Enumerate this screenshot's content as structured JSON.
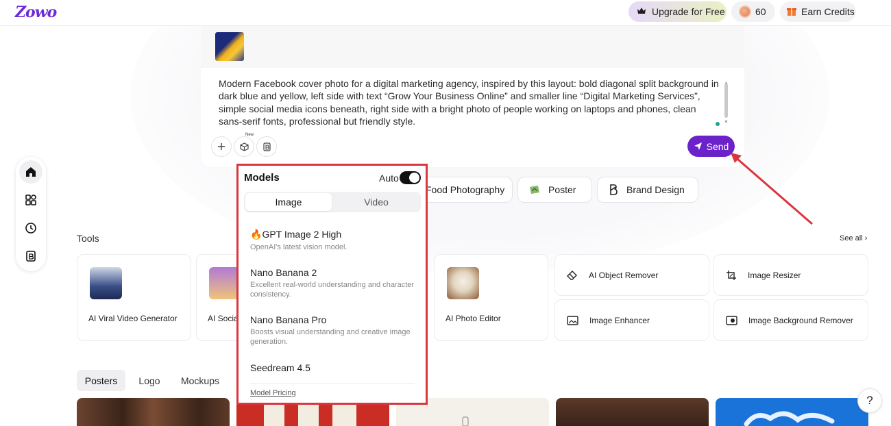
{
  "header": {
    "logo": "Zowo",
    "upgrade_label": "Upgrade for Free",
    "credits_count": "60",
    "earn_label": "Earn Credits"
  },
  "sidebar": {
    "items": [
      {
        "icon": "home-icon"
      },
      {
        "icon": "apps-icon"
      },
      {
        "icon": "history-icon"
      },
      {
        "icon": "brand-icon"
      }
    ]
  },
  "prompt": {
    "text": "Modern Facebook cover photo for a digital marketing agency, inspired by this layout: bold diagonal split background in dark blue and yellow, left side with text “Grow Your Business Online” and smaller line “Digital Marketing Services”, simple social media icons beneath, right side with a bright photo of people working on laptops and phones, clean sans-serif fonts, professional but friendly style.",
    "new_tag": "New",
    "send_label": "Send"
  },
  "categories": [
    "Food Photography",
    "Poster",
    "Brand Design"
  ],
  "tools": {
    "label": "Tools",
    "see_all": "See all",
    "cards": [
      {
        "name": "AI Viral Video Generator"
      },
      {
        "name": "AI Social"
      },
      {
        "name": "AI Photo Editor"
      }
    ],
    "mini": [
      {
        "name": "AI Object Remover",
        "icon": "eraser-icon"
      },
      {
        "name": "Image Resizer",
        "icon": "resize-icon"
      },
      {
        "name": "Image Enhancer",
        "icon": "enhance-icon"
      },
      {
        "name": "Image Background Remover",
        "icon": "bg-remove-icon"
      }
    ]
  },
  "gallery": {
    "tabs": [
      "Posters",
      "Logo",
      "Mockups"
    ],
    "active_tab": "Posters"
  },
  "models_panel": {
    "title": "Models",
    "auto_label": "Auto",
    "auto_on": true,
    "tabs": [
      "Image",
      "Video"
    ],
    "active_tab": "Image",
    "items": [
      {
        "name": "GPT Image 2 High",
        "desc": "OpenAI's latest vision model."
      },
      {
        "name": "Nano Banana 2",
        "desc": "Excellent real-world understanding and character consistency."
      },
      {
        "name": "Nano Banana Pro",
        "desc": "Boosts visual understanding and creative image generation."
      },
      {
        "name": "Seedream 4.5",
        "desc": ""
      }
    ],
    "pricing_link": "Model Pricing"
  },
  "colors": {
    "brand": "#6b22c9",
    "highlight": "#d9363e",
    "send_bg": "#6b22c9"
  }
}
